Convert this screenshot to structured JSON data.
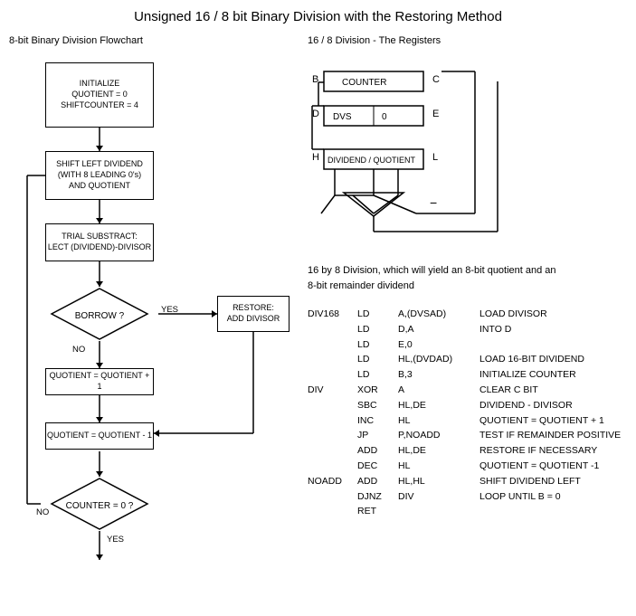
{
  "title": "Unsigned 16 / 8 bit Binary Division with the Restoring Method",
  "left_section_label": "8-bit Binary Division Flowchart",
  "right_section_label": "16 / 8 Division - The Registers",
  "flowchart": {
    "boxes": [
      {
        "id": "init",
        "text": "INITIALIZE\nQUOTIENT = 0\nSHIFTCOUNTER = 4"
      },
      {
        "id": "shift",
        "text": "SHIFT LEFT DIVIDEND\n(WITH 8 LEADING 0's)\nAND QUOTIENT"
      },
      {
        "id": "trial",
        "text": "TRIAL SUBSTRACT:\nLECT (DIVIDEND)-DIVISOR"
      },
      {
        "id": "borrow",
        "text": "BORROW ?"
      },
      {
        "id": "quotient_plus",
        "text": "QUOTIENT = QUOTIENT + 1"
      },
      {
        "id": "restore",
        "text": "RESTORE:\nADD DIVISOR"
      },
      {
        "id": "quotient_minus",
        "text": "QUOTIENT = QUOTIENT - 1"
      },
      {
        "id": "counter",
        "text": "COUNTER = 0 ?"
      }
    ],
    "yes_label": "YES",
    "no_label": "NO"
  },
  "registers": {
    "B_label": "B",
    "C_label": "C",
    "D_label": "D",
    "E_label": "E",
    "H_label": "H",
    "L_label": "L",
    "counter_text": "COUNTER",
    "dvs_text": "DVS",
    "zero_text": "0",
    "dividend_quotient_text": "DIVIDEND / QUOTIENT"
  },
  "description": "16 by 8 Division, which will yield an 8-bit quotient and an 8-bit remainder dividend",
  "assembly": {
    "rows": [
      {
        "label": "DIV168",
        "mnemonic": "LD",
        "operand": "A,(DVSAD)",
        "comment": "LOAD DIVISOR"
      },
      {
        "label": "",
        "mnemonic": "LD",
        "operand": "D,A",
        "comment": "INTO D"
      },
      {
        "label": "",
        "mnemonic": "LD",
        "operand": "E,0",
        "comment": ""
      },
      {
        "label": "",
        "mnemonic": "LD",
        "operand": "HL,(DVDAD)",
        "comment": "LOAD 16-BIT DIVIDEND"
      },
      {
        "label": "",
        "mnemonic": "LD",
        "operand": "B,3",
        "comment": "INITIALIZE COUNTER"
      },
      {
        "label": "DIV",
        "mnemonic": "XOR",
        "operand": "A",
        "comment": "CLEAR C BIT"
      },
      {
        "label": "",
        "mnemonic": "SBC",
        "operand": "HL,DE",
        "comment": "DIVIDEND - DIVISOR"
      },
      {
        "label": "",
        "mnemonic": "INC",
        "operand": "HL",
        "comment": "QUOTIENT = QUOTIENT + 1"
      },
      {
        "label": "",
        "mnemonic": "JP",
        "operand": "P,NOADD",
        "comment": "TEST IF REMAINDER POSITIVE"
      },
      {
        "label": "",
        "mnemonic": "ADD",
        "operand": "HL,DE",
        "comment": "RESTORE IF NECESSARY"
      },
      {
        "label": "",
        "mnemonic": "DEC",
        "operand": "HL",
        "comment": "QUOTIENT = QUOTIENT -1"
      },
      {
        "label": "NOADD",
        "mnemonic": "ADD",
        "operand": "HL,HL",
        "comment": "SHIFT DIVIDEND LEFT"
      },
      {
        "label": "",
        "mnemonic": "DJNZ",
        "operand": "DIV",
        "comment": "LOOP UNTIL B = 0"
      },
      {
        "label": "",
        "mnemonic": "RET",
        "operand": "",
        "comment": ""
      }
    ]
  }
}
